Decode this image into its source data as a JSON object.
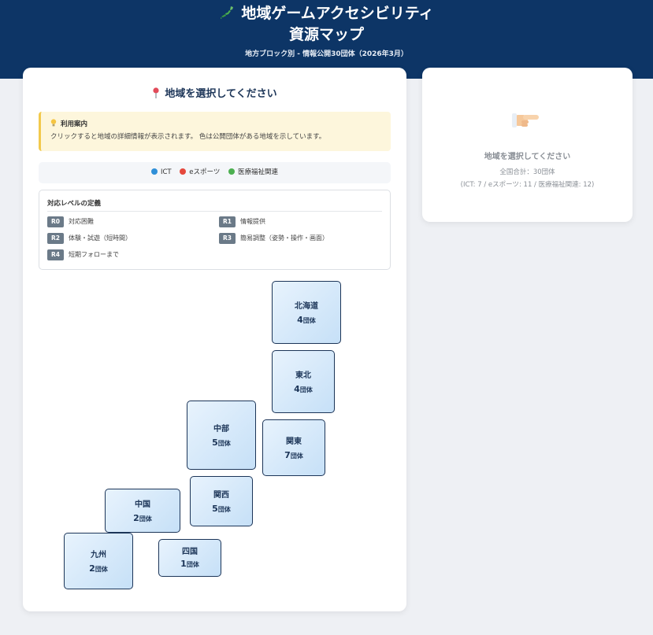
{
  "header": {
    "title_line1": "地域ゲームアクセシビリティ",
    "title_line2": "資源マップ",
    "subtitle": "地方ブロック別 - 情報公開30団体（2026年3月）"
  },
  "left_panel": {
    "heading": "地域を選択してください",
    "guide": {
      "title": "利用案内",
      "text": "クリックすると地域の詳細情報が表示されます。 色は公開団体がある地域を示しています。"
    },
    "legend": [
      {
        "label": "ICT",
        "color": "#2f8fd8"
      },
      {
        "label": "eスポーツ",
        "color": "#e5483c"
      },
      {
        "label": "医療福祉関連",
        "color": "#4caf50"
      }
    ],
    "levels": {
      "title": "対応レベルの定義",
      "items": [
        {
          "code": "R0",
          "label": "対応困難"
        },
        {
          "code": "R1",
          "label": "情報提供"
        },
        {
          "code": "R2",
          "label": "体験・試遊（短時間）"
        },
        {
          "code": "R3",
          "label": "簡易調整（姿勢・操作・画面）"
        },
        {
          "code": "R4",
          "label": "短期フォローまで"
        }
      ]
    },
    "regions": [
      {
        "name": "北海道",
        "count": "4",
        "unit": "団体"
      },
      {
        "name": "東北",
        "count": "4",
        "unit": "団体"
      },
      {
        "name": "中部",
        "count": "5",
        "unit": "団体"
      },
      {
        "name": "関東",
        "count": "7",
        "unit": "団体"
      },
      {
        "name": "関西",
        "count": "5",
        "unit": "団体"
      },
      {
        "name": "中国",
        "count": "2",
        "unit": "団体"
      },
      {
        "name": "九州",
        "count": "2",
        "unit": "団体"
      },
      {
        "name": "四国",
        "count": "1",
        "unit": "団体"
      }
    ]
  },
  "right_panel": {
    "title": "地域を選択してください",
    "total": "全国合計：30団体",
    "breakdown": "(ICT: 7 / eスポーツ: 11 / 医療福祉関連: 12)"
  }
}
